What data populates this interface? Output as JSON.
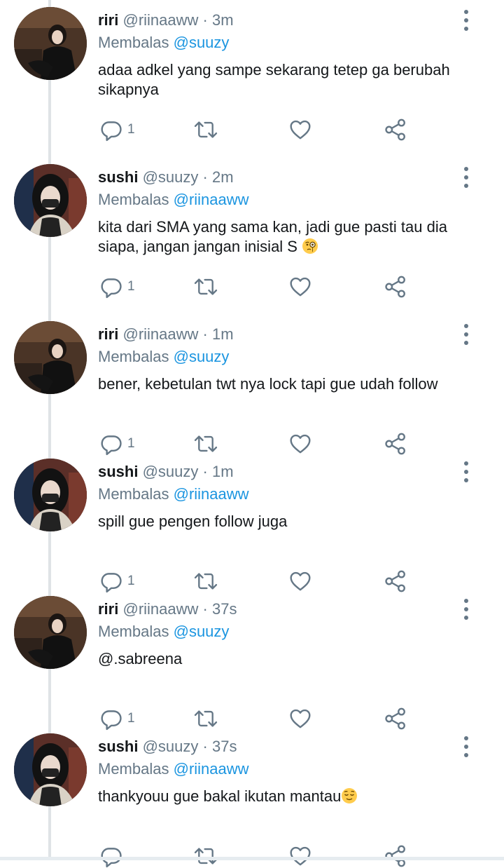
{
  "reply_prefix": "Membalas",
  "tweets": [
    {
      "name": "riri",
      "handle": "@riinaaww",
      "sep": "·",
      "time": "3m",
      "reply_to": "@suuzy",
      "text": "adaa adkel yang sampe sekarang tetep ga berubah sikapnya",
      "emoji": "",
      "reply_count": "1",
      "avatar": "riri"
    },
    {
      "name": "sushi",
      "handle": "@suuzy",
      "sep": "·",
      "time": "2m",
      "reply_to": "@riinaaww",
      "text": "kita dari SMA yang sama kan, jadi gue pasti tau dia siapa, jangan jangan inisial S ",
      "emoji": "monocle-face",
      "reply_count": "1",
      "avatar": "sushi"
    },
    {
      "name": "riri",
      "handle": "@riinaaww",
      "sep": "·",
      "time": "1m",
      "reply_to": "@suuzy",
      "text": "bener, kebetulan twt nya lock tapi gue udah follow",
      "emoji": "",
      "reply_count": "1",
      "avatar": "riri"
    },
    {
      "name": "sushi",
      "handle": "@suuzy",
      "sep": "·",
      "time": "1m",
      "reply_to": "@riinaaww",
      "text": "spill gue pengen follow juga",
      "emoji": "",
      "reply_count": "1",
      "avatar": "sushi"
    },
    {
      "name": "riri",
      "handle": "@riinaaww",
      "sep": "·",
      "time": "37s",
      "reply_to": "@suuzy",
      "text": "@.sabreena",
      "emoji": "",
      "reply_count": "1",
      "avatar": "riri"
    },
    {
      "name": "sushi",
      "handle": "@suuzy",
      "sep": "·",
      "time": "37s",
      "reply_to": "@riinaaww",
      "text": "thankyouu gue bakal ikutan mantau",
      "emoji": "relieved-face",
      "reply_count": "",
      "avatar": "sushi"
    }
  ],
  "colors": {
    "text": "#14171a",
    "secondary": "#657786",
    "link": "#1b95e0",
    "thread_line": "#dfe3e6"
  },
  "icons": {
    "reply": "reply-icon",
    "retweet": "retweet-icon",
    "like": "like-icon",
    "share": "share-icon",
    "more": "more-vertical-icon"
  }
}
